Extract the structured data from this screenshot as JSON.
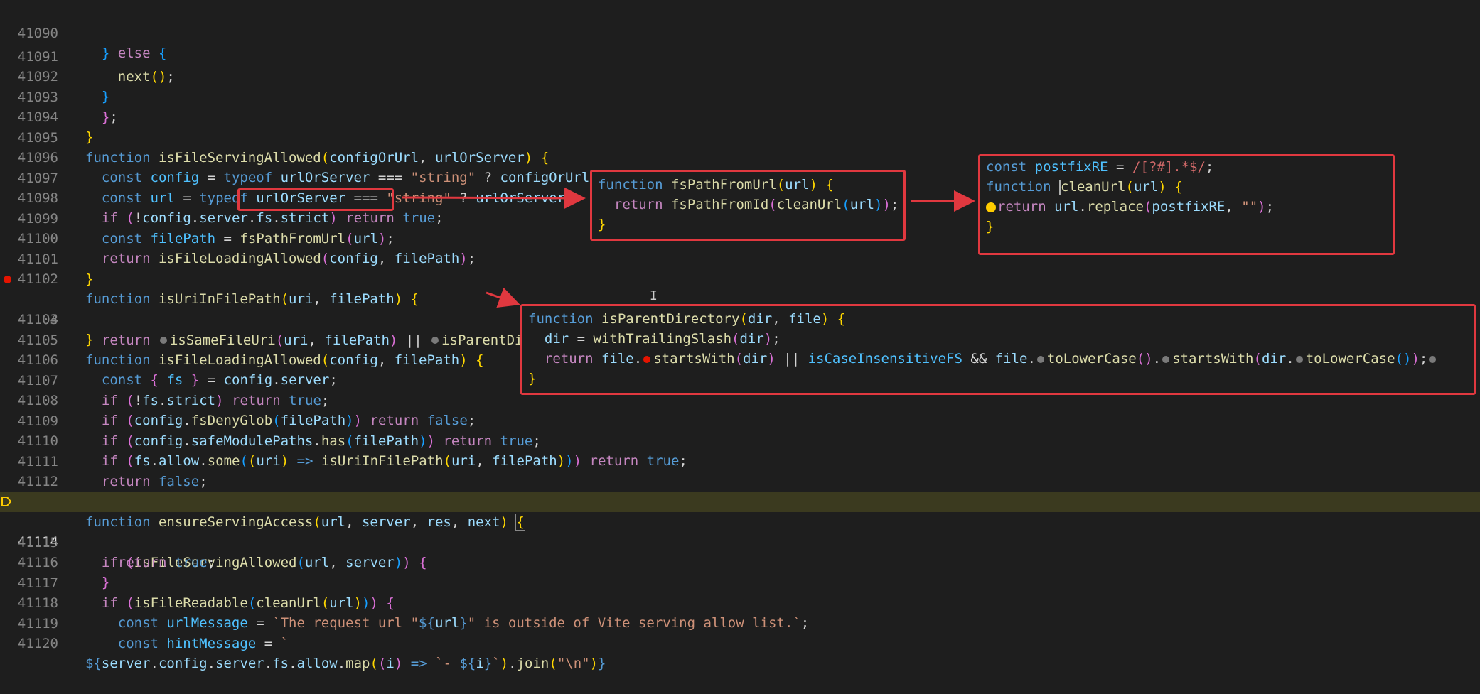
{
  "editor": {
    "current_line": "41114",
    "breakpoint_line": "41103"
  },
  "lines": [
    {
      "n": "41090",
      "t": "  } else {"
    },
    {
      "n": "41091",
      "t": "    next();"
    },
    {
      "n": "41092",
      "t": "  }"
    },
    {
      "n": "41093",
      "t": "  };"
    },
    {
      "n": "41094",
      "t": "}"
    },
    {
      "n": "41095",
      "t": "function isFileServingAllowed(configOrUrl, urlOrServer) {"
    },
    {
      "n": "41096",
      "t": "  const config = typeof urlOrServer === \"string\" ? configOrUrl : urlOrServer.config;"
    },
    {
      "n": "41097",
      "t": "  const url = typeof urlOrServer === \"string\" ? urlOrServer : configOrUrl;"
    },
    {
      "n": "41098",
      "t": "  if (!config.server.fs.strict) return true;"
    },
    {
      "n": "41099",
      "t": "  const filePath = fsPathFromUrl(url);"
    },
    {
      "n": "41100",
      "t": "  return isFileLoadingAllowed(config, filePath);"
    },
    {
      "n": "41101",
      "t": "}"
    },
    {
      "n": "41102",
      "t": "function isUriInFilePath(uri, filePath) {"
    },
    {
      "n": "41103",
      "t": "  return isSameFileUri(uri, filePath) || isParentDirectory(uri, filePath);"
    },
    {
      "n": "41104",
      "t": "}"
    },
    {
      "n": "41105",
      "t": "function isFileLoadingAllowed(config, filePath) {"
    },
    {
      "n": "41106",
      "t": "  const { fs } = config.server;"
    },
    {
      "n": "41107",
      "t": "  if (!fs.strict) return true;"
    },
    {
      "n": "41108",
      "t": "  if (config.fsDenyGlob(filePath)) return false;"
    },
    {
      "n": "41109",
      "t": "  if (config.safeModulePaths.has(filePath)) return true;"
    },
    {
      "n": "41110",
      "t": "  if (fs.allow.some((uri) => isUriInFilePath(uri, filePath))) return true;"
    },
    {
      "n": "41111",
      "t": "  return false;"
    },
    {
      "n": "41112",
      "t": "}"
    },
    {
      "n": "41113",
      "t": "function ensureServingAccess(url, server, res, next) {"
    },
    {
      "n": "41114",
      "t": "  if (isFileServingAllowed(url, server)) {"
    },
    {
      "n": "41115",
      "t": "    return true;"
    },
    {
      "n": "41116",
      "t": "  }"
    },
    {
      "n": "41117",
      "t": "  if (isFileReadable(cleanUrl(url))) {"
    },
    {
      "n": "41118",
      "t": "    const urlMessage = `The request url \"${url}\" is outside of Vite serving allow list.`;"
    },
    {
      "n": "41119",
      "t": "    const hintMessage = `"
    },
    {
      "n": "41120",
      "t": "${server.config.server.fs.allow.map((i) => `- ${i}`).join(\"\\n\")}"
    }
  ],
  "popups": {
    "fs_path_from_url": [
      "function fsPathFromUrl(url) {",
      "  return fsPathFromId(cleanUrl(url));",
      "}"
    ],
    "clean_url": [
      "const postfixRE = /[?#].*$/;",
      "function cleanUrl(url) {",
      "  return url.replace(postfixRE, \"\");",
      "}"
    ],
    "is_parent_directory": [
      "function isParentDirectory(dir, file) {",
      "  dir = withTrailingSlash(dir);",
      "  return file.startsWith(dir) || isCaseInsensitiveFS && file.toLowerCase().startsWith(dir.toLowerCase());",
      "}"
    ]
  },
  "colors": {
    "annotation_red": "#e0383f",
    "current_line_bg": "#3b3a1f",
    "breakpoint": "#e51400"
  }
}
